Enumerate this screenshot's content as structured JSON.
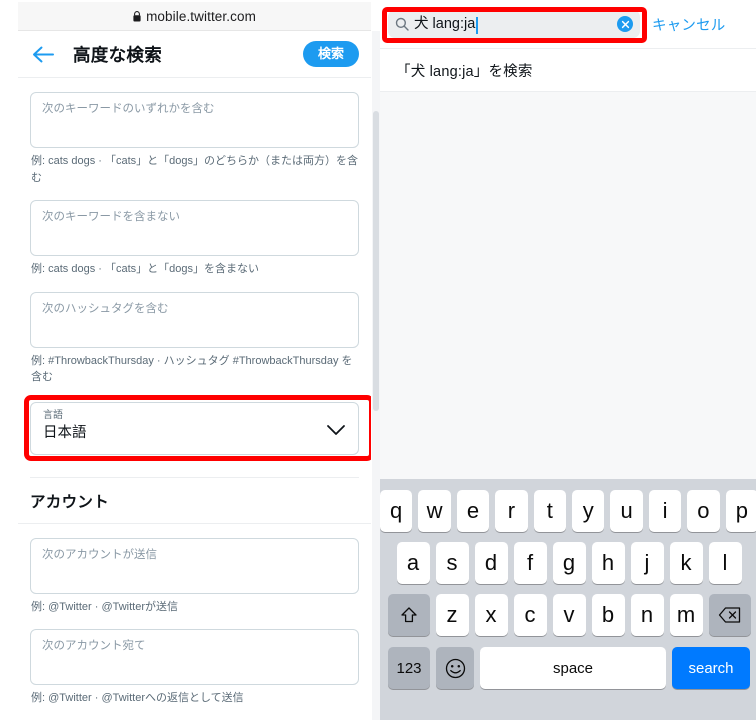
{
  "browser": {
    "url": "mobile.twitter.com",
    "lock_icon": "lock-icon"
  },
  "left_panel": {
    "header": {
      "back_icon": "back-arrow-icon",
      "title": "高度な検索",
      "search_button": "検索"
    },
    "fields": [
      {
        "placeholder": "次のキーワードのいずれかを含む",
        "hint": "例: cats dogs · 「cats」と「dogs」のどちらか（または両方）を含む"
      },
      {
        "placeholder": "次のキーワードを含まない",
        "hint": "例: cats dogs · 「cats」と「dogs」を含まない"
      },
      {
        "placeholder": "次のハッシュタグを含む",
        "hint": "例: #ThrowbackThursday · ハッシュタグ #ThrowbackThursday を含む"
      }
    ],
    "language": {
      "label": "言語",
      "value": "日本語",
      "chevron_icon": "chevron-down-icon",
      "highlighted": true
    },
    "account_section": {
      "title": "アカウント",
      "fields": [
        {
          "placeholder": "次のアカウントが送信",
          "hint": "例: @Twitter · @Twitterが送信"
        },
        {
          "placeholder": "次のアカウント宛て",
          "hint": "例: @Twitter · @Twitterへの返信として送信"
        }
      ]
    }
  },
  "right_panel": {
    "search": {
      "magnifier_icon": "search-icon",
      "value": "犬 lang:ja",
      "clear_icon": "clear-circle-icon",
      "cancel_label": "キャンセル",
      "highlighted": true
    },
    "suggestion": "「犬 lang:ja」を検索",
    "keyboard": {
      "row1": [
        "q",
        "w",
        "e",
        "r",
        "t",
        "y",
        "u",
        "i",
        "o",
        "p"
      ],
      "row2": [
        "a",
        "s",
        "d",
        "f",
        "g",
        "h",
        "j",
        "k",
        "l"
      ],
      "row3": [
        "z",
        "x",
        "c",
        "v",
        "b",
        "n",
        "m"
      ],
      "shift_icon": "shift-up-arrow-icon",
      "backspace_icon": "backspace-delete-icon",
      "numbers_key": "123",
      "emoji_icon": "emoji-smiley-icon",
      "space_key": "space",
      "return_key": "search"
    }
  },
  "colors": {
    "accent_blue": "#1d9bf0",
    "keyboard_blue": "#007aff",
    "highlight_red": "#ff0000"
  }
}
